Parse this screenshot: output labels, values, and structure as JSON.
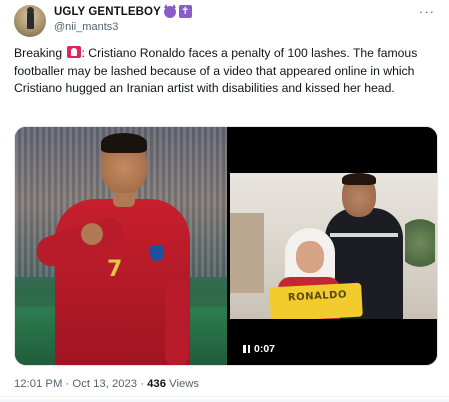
{
  "author": {
    "display_name": "UGLY GENTLEBOY",
    "handle": "@nii_mants3",
    "avatar_icon": "avatar-image"
  },
  "more_icon": "more-horizontal-icon",
  "more_label": "···",
  "tweet": {
    "text_prefix": "Breaking",
    "text_body": ": Cristiano Ronaldo faces a penalty of 100 lashes. The famous footballer may be lashed because of a video that appeared online in which Cristiano hugged an Iranian artist with disabilities and kissed her head."
  },
  "media": {
    "left_image_icon": "cristiano-ronaldo-photo",
    "right_video_icon": "video-thumbnail",
    "jersey_text": "RONALDO",
    "shirt_number": "7",
    "video_duration": "0:07"
  },
  "meta": {
    "time": "12:01 PM",
    "separator": " · ",
    "date": "Oct 13, 2023",
    "views_count": "436",
    "views_label": " Views"
  },
  "colors": {
    "text": "#0f1419",
    "secondary": "#536471",
    "emoji_purple": "#8b5cc9",
    "flag_red": "#e0245e"
  }
}
